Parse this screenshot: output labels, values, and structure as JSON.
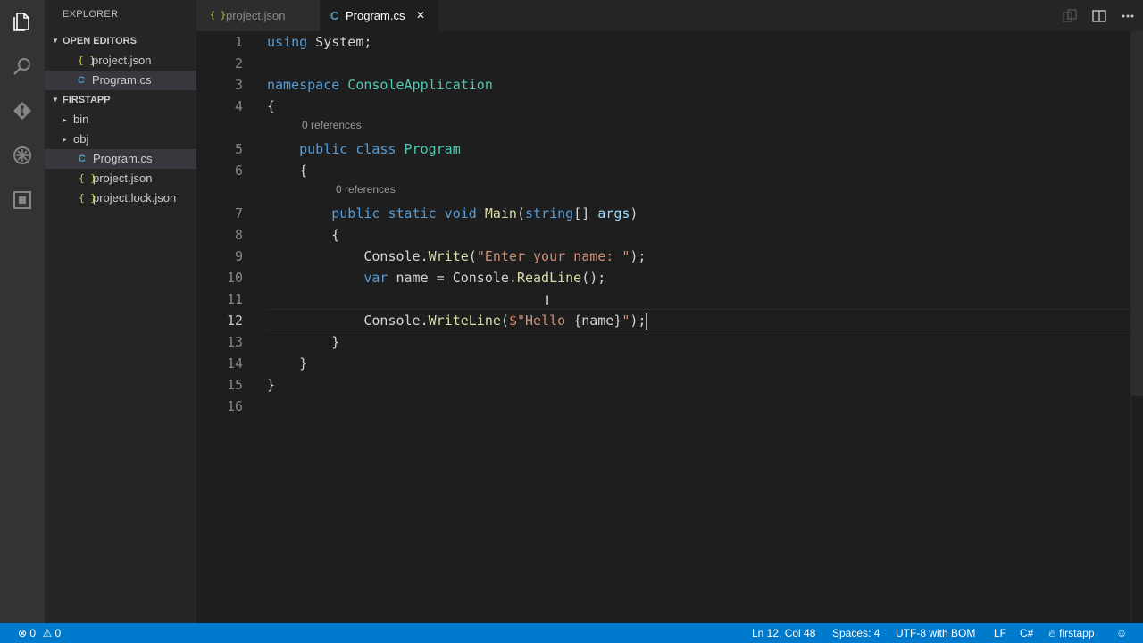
{
  "sidebar": {
    "title": "EXPLORER",
    "open_editors": {
      "header": "OPEN EDITORS",
      "items": [
        {
          "icon": "{ }",
          "label": "project.json"
        },
        {
          "icon": "C",
          "label": "Program.cs"
        }
      ]
    },
    "folder": {
      "header": "FIRSTAPP",
      "items": [
        {
          "icon": "▸",
          "label": "bin"
        },
        {
          "icon": "▸",
          "label": "obj"
        },
        {
          "icon": "C",
          "label": "Program.cs"
        },
        {
          "icon": "{ }",
          "label": "project.json"
        },
        {
          "icon": "{ }",
          "label": "project.lock.json"
        }
      ]
    }
  },
  "tabs": [
    {
      "icon": "{ }",
      "label": "project.json",
      "active": false
    },
    {
      "icon": "C",
      "label": "Program.cs",
      "active": true,
      "close": "✕"
    }
  ],
  "editor": {
    "line_numbers": [
      "1",
      "2",
      "3",
      "4",
      "5",
      "6",
      "7",
      "8",
      "9",
      "10",
      "11",
      "12",
      "13",
      "14",
      "15",
      "16"
    ],
    "codelens": [
      "0 references",
      "0 references"
    ],
    "current_line": 12
  },
  "statusbar": {
    "errors": "0",
    "warnings": "0",
    "position": "Ln 12, Col 48",
    "spaces": "Spaces: 4",
    "encoding": "UTF-8 with BOM",
    "eol": "LF",
    "language": "C#",
    "project": "firstapp"
  },
  "colors": {
    "statusbar_bg": "#007acc",
    "keyword": "#569cd6",
    "type": "#4ec9b0",
    "function": "#dcdcaa",
    "string": "#ce9178"
  },
  "code_lines": [
    [
      [
        "kw",
        "using"
      ],
      [
        "",
        "System;"
      ]
    ],
    [],
    [
      [
        "kw",
        "namespace"
      ],
      [
        "ty",
        "ConsoleApplication"
      ]
    ],
    [
      [
        "",
        "{"
      ]
    ],
    [
      [
        "",
        "    "
      ],
      [
        "kw",
        "public class"
      ],
      [
        "ty",
        "Program"
      ]
    ],
    [
      [
        "",
        "    {"
      ]
    ],
    [
      [
        "",
        "        "
      ],
      [
        "kw",
        "public static void"
      ],
      [
        "fn",
        "Main"
      ],
      [
        "",
        "("
      ],
      [
        "kw",
        "string"
      ],
      [
        "",
        "[] "
      ],
      [
        "pm",
        "args"
      ],
      [
        "",
        ")"
      ]
    ],
    [
      [
        "",
        "        {"
      ]
    ],
    [
      [
        "",
        "            Console."
      ],
      [
        "fn",
        "Write"
      ],
      [
        "",
        "("
      ],
      [
        "st",
        "\"Enter your name: \""
      ],
      [
        "",
        ");"
      ]
    ],
    [
      [
        "",
        "            "
      ],
      [
        "kw",
        "var"
      ],
      [
        "",
        "name = Console."
      ],
      [
        "fn",
        "ReadLine"
      ],
      [
        "",
        "();"
      ]
    ],
    [],
    [
      [
        "",
        "            Console."
      ],
      [
        "fn",
        "WriteLine"
      ],
      [
        "",
        "("
      ],
      [
        "st",
        "$\"Hello "
      ],
      [
        "",
        "{name}"
      ],
      [
        "st",
        "\""
      ],
      [
        "",
        ");"
      ]
    ],
    [
      [
        "",
        "        }"
      ]
    ],
    [
      [
        "",
        "    }"
      ]
    ],
    [
      [
        "",
        "}"
      ]
    ],
    []
  ]
}
